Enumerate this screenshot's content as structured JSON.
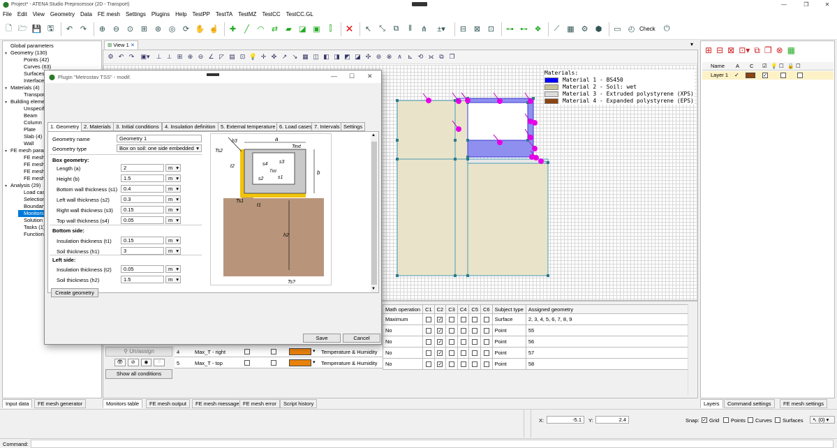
{
  "window": {
    "title": "Project* - ATENA Studio Preprocessor (2D - Transport)"
  },
  "menu": [
    "File",
    "Edit",
    "View",
    "Geometry",
    "Data",
    "FE mesh",
    "Settings",
    "Plugins",
    "Help",
    "TestPP",
    "TestTA",
    "TestMZ",
    "TestCC",
    "TestCC.GL"
  ],
  "toolbar": {
    "check_label": "Check"
  },
  "tree": [
    {
      "label": "Global parameters",
      "level": 0,
      "exp": ""
    },
    {
      "label": "Geometry (130)",
      "level": 0,
      "exp": "▾"
    },
    {
      "label": "Points (42)",
      "level": 1,
      "exp": ""
    },
    {
      "label": "Curves (63)",
      "level": 1,
      "exp": ""
    },
    {
      "label": "Surfaces (2",
      "level": 1,
      "exp": ""
    },
    {
      "label": "Interface 2",
      "level": 1,
      "exp": ""
    },
    {
      "label": "Materials (4)",
      "level": 0,
      "exp": "▾"
    },
    {
      "label": "Transport (",
      "level": 1,
      "exp": ""
    },
    {
      "label": "Building eleme",
      "level": 0,
      "exp": "▾"
    },
    {
      "label": "Unspecified",
      "level": 1,
      "exp": ""
    },
    {
      "label": "Beam",
      "level": 1,
      "exp": ""
    },
    {
      "label": "Column",
      "level": 1,
      "exp": ""
    },
    {
      "label": "Plate",
      "level": 1,
      "exp": ""
    },
    {
      "label": "Slab (4)",
      "level": 1,
      "exp": ""
    },
    {
      "label": "Wall",
      "level": 1,
      "exp": ""
    },
    {
      "label": "FE mesh param",
      "level": 0,
      "exp": "▾"
    },
    {
      "label": "FE mesh siz",
      "level": 1,
      "exp": ""
    },
    {
      "label": "FE mesh ty",
      "level": 1,
      "exp": ""
    },
    {
      "label": "FE mesh ad",
      "level": 1,
      "exp": ""
    },
    {
      "label": "FE mesh ex",
      "level": 1,
      "exp": ""
    },
    {
      "label": "Analysis (29)",
      "level": 0,
      "exp": "▾"
    },
    {
      "label": "Load cases",
      "level": 1,
      "exp": ""
    },
    {
      "label": "Selections",
      "level": 1,
      "exp": ""
    },
    {
      "label": "Boundary c",
      "level": 1,
      "exp": ""
    },
    {
      "label": "Monitors (5",
      "level": 1,
      "exp": "",
      "selected": true
    },
    {
      "label": "Solution pa",
      "level": 1,
      "exp": ""
    },
    {
      "label": "Tasks (1)",
      "level": 1,
      "exp": ""
    },
    {
      "label": "Functions (",
      "level": 1,
      "exp": ""
    }
  ],
  "left_tabs": [
    "Input data",
    "FE mesh generator"
  ],
  "view": {
    "tab_label": "View 1"
  },
  "materials_legend": {
    "title": "Materials:",
    "items": [
      {
        "label": "Material 1 - BS450",
        "color": "#0000ff"
      },
      {
        "label": "Material 2 - Soil: wet",
        "color": "#c8c29a"
      },
      {
        "label": "Material 3 - Extruded polystyrene (XPS)",
        "color": "#dcdcdc"
      },
      {
        "label": "Material 4 - Expanded polystyrene (EPS)",
        "color": "#8b4513"
      }
    ]
  },
  "dialog": {
    "title": "Plugin \"Metrostav TSS\" - modif.",
    "tabs": [
      "1. Geometry",
      "2. Materials",
      "3. Initial conditions",
      "4. Insulation definition",
      "5. External temperature",
      "6. Load cases",
      "7. Intervals",
      "Settings"
    ],
    "geometry_name_label": "Geometry name",
    "geometry_name_value": "Geometry 1",
    "geometry_type_label": "Geometry type",
    "geometry_type_value": "Box on soil: one side embedded",
    "box_header": "Box geometry:",
    "box_fields": [
      {
        "label": "Length (a)",
        "value": "2",
        "unit": "m"
      },
      {
        "label": "Height (b)",
        "value": "1.5",
        "unit": "m"
      },
      {
        "label": "Bottom wall thickness (s1)",
        "value": "0.4",
        "unit": "m"
      },
      {
        "label": "Left wall thickness (s2)",
        "value": "0.3",
        "unit": "m"
      },
      {
        "label": "Right wall thickness (s3)",
        "value": "0.15",
        "unit": "m"
      },
      {
        "label": "Top wall thickness (s4)",
        "value": "0.05",
        "unit": "m"
      }
    ],
    "bottom_header": "Bottom side:",
    "bottom_fields": [
      {
        "label": "Insulation thickness (t1)",
        "value": "0.15",
        "unit": "m"
      },
      {
        "label": "Soil thickness (h1)",
        "value": "3",
        "unit": "m"
      }
    ],
    "left_header": "Left side:",
    "left_fields": [
      {
        "label": "Insulation thickness (t2)",
        "value": "0.05",
        "unit": "m"
      },
      {
        "label": "Soil thickness (h2)",
        "value": "1.5",
        "unit": "m"
      }
    ],
    "create_label": "Create geometry",
    "save_label": "Save",
    "cancel_label": "Cancel",
    "diagram_labels": {
      "h3": "h3",
      "a": "a",
      "text": "Text",
      "ts2": "Ts2",
      "t2": "t2",
      "s4": "s4",
      "s3": "s3",
      "tint": "Tint",
      "s2": "s2",
      "s1": "s1",
      "b": "b",
      "t1": "t1",
      "ts1": "Ts1",
      "h2": "h2",
      "tsp": "Ts?"
    }
  },
  "monitors": {
    "headers": [
      "Math operation",
      "C1",
      "C2",
      "C3",
      "C4",
      "C5",
      "C6",
      "Subject type",
      "Assigned geometry"
    ],
    "rows": [
      {
        "math": "Maximum",
        "c": [
          false,
          true,
          false,
          false,
          false,
          false
        ],
        "subject": "Surface",
        "geom": "2, 3, 4, 5, 6, 7, 8, 9"
      },
      {
        "math": "No",
        "c": [
          false,
          true,
          false,
          false,
          false,
          false
        ],
        "subject": "Point",
        "geom": "55"
      },
      {
        "math": "No",
        "c": [
          false,
          true,
          false,
          false,
          false,
          false
        ],
        "subject": "Point",
        "geom": "56"
      },
      {
        "math": "No",
        "c": [
          false,
          true,
          false,
          false,
          false,
          false
        ],
        "subject": "Point",
        "geom": "57"
      },
      {
        "math": "No",
        "c": [
          false,
          true,
          false,
          false,
          false,
          false
        ],
        "subject": "Point",
        "geom": "58"
      }
    ],
    "left_rows": [
      {
        "num": "4",
        "name": "Max_T - right",
        "quantity": "Temperature & Humidity",
        "color": "#e8820c"
      },
      {
        "num": "5",
        "name": "Max_T - top",
        "quantity": "Temperature & Humidity",
        "color": "#e8820c"
      }
    ],
    "unassign_label": "Un/assign",
    "show_all_label": "Show all conditions"
  },
  "bottom_tabs": [
    "Monitors table",
    "FE mesh output",
    "FE mesh message",
    "FE mesh error",
    "Script history"
  ],
  "layers": {
    "headers": [
      "Name",
      "A",
      "C"
    ],
    "row": {
      "name": "Layer 1"
    }
  },
  "right_tabs": [
    "Layers",
    "Command settings",
    "FE mesh settings"
  ],
  "status": {
    "x_label": "X:",
    "x_value": "-5.1",
    "y_label": "Y:",
    "y_value": "2.4",
    "snap_label": "Snap:",
    "grid_label": "Grid",
    "points_label": "Points",
    "curves_label": "Curves",
    "surfaces_label": "Surfaces",
    "cursor_value": "(0)"
  },
  "command": {
    "label": "Command:"
  }
}
